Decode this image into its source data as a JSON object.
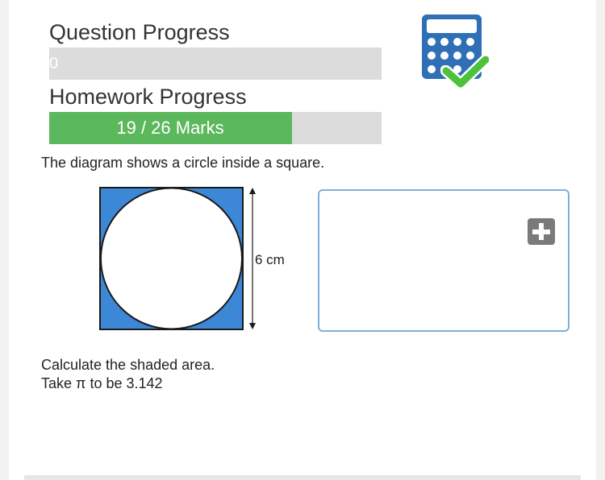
{
  "question_progress": {
    "heading": "Question Progress",
    "value_text": "0",
    "fraction": 0
  },
  "homework_progress": {
    "heading": "Homework Progress",
    "value_text": "19 / 26 Marks",
    "earned": 19,
    "total": 26
  },
  "calculator": {
    "icon": "calculator-icon",
    "status_icon": "checkmark-icon",
    "color": "#2f6fb5",
    "check_color": "#4cc23a"
  },
  "question": {
    "intro": "The diagram shows a circle inside a square.",
    "instruction_line1": "Calculate the shaded area.",
    "instruction_line2": "Take π to be 3.142"
  },
  "diagram": {
    "dimension_label": "6 cm",
    "shaded_color": "#3c88d6"
  },
  "answer": {
    "add_icon": "plus-icon",
    "value": ""
  },
  "colors": {
    "progress_fill": "#5cb85c",
    "progress_track": "#dcdcdc",
    "answer_border": "#7fb0d9"
  }
}
